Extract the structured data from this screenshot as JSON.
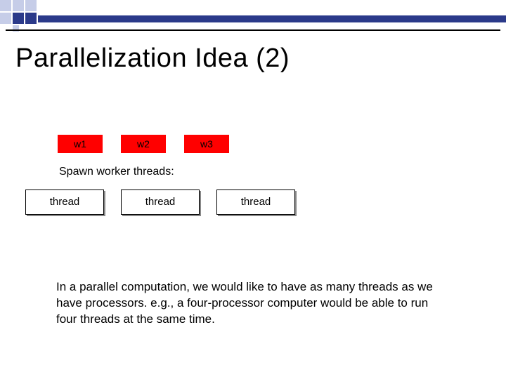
{
  "title": "Parallelization Idea (2)",
  "workers": {
    "w1": "w1",
    "w2": "w2",
    "w3": "w3"
  },
  "spawn_label": "Spawn worker threads:",
  "threads": {
    "t1": "thread",
    "t2": "thread",
    "t3": "thread"
  },
  "paragraph": "In a parallel computation, we would like to have as many threads as we have processors. e.g., a four-processor computer would be able to run four threads at the same time.",
  "colors": {
    "accent_dark": "#2b3a8a",
    "accent_light": "#c6cde8",
    "worker_bg": "#ff0000"
  }
}
